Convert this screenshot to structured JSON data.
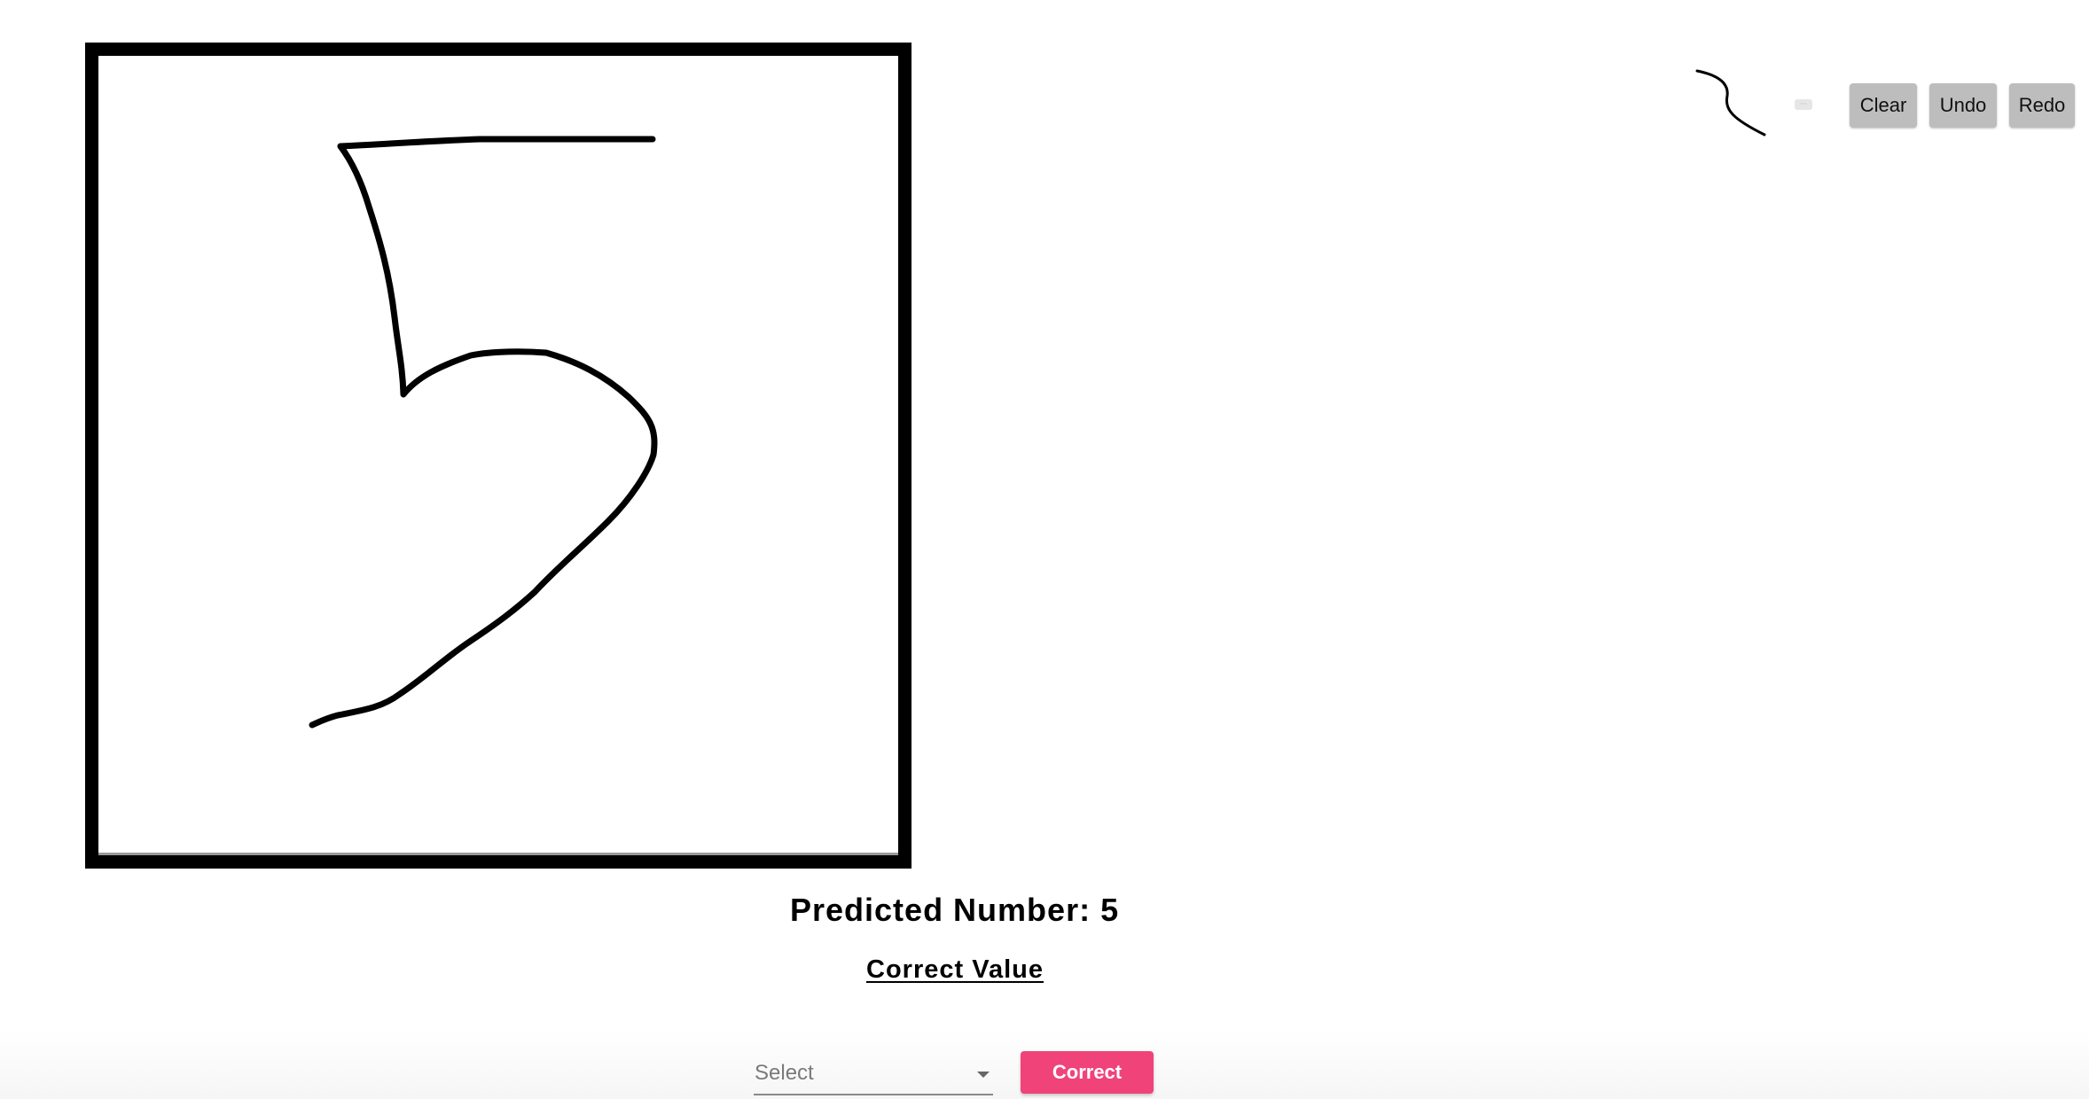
{
  "canvas": {
    "stroke_color": "#000000",
    "frame_color": "#000000",
    "background": "#ffffff"
  },
  "toolbar": {
    "brush_preview_icon": "brush-stroke-icon",
    "color_swatch_icon": "color-swatch-icon",
    "clear_label": "Clear",
    "undo_label": "Undo",
    "redo_label": "Redo",
    "button_color": "#bdbdbd"
  },
  "result": {
    "prediction_text": "Predicted Number: 5",
    "correct_heading": "Correct Value"
  },
  "correction": {
    "select_placeholder": "Select",
    "submit_label": "Correct",
    "submit_color": "#f0437a"
  }
}
